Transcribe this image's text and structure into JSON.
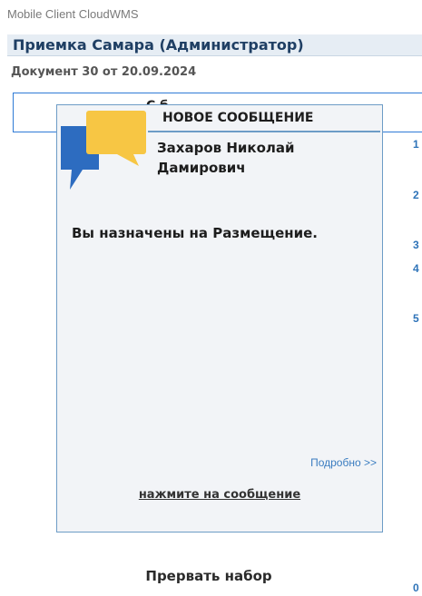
{
  "app": {
    "title": "Mobile Client CloudWMS"
  },
  "header": {
    "title": "Приемка Самара (Администратор)"
  },
  "document": {
    "line": "Документ 30 от 20.09.2024"
  },
  "list": {
    "frame_label": "С б"
  },
  "right_column": {
    "numbers": [
      "1",
      "2",
      "3",
      "4",
      "5",
      "0"
    ]
  },
  "popup": {
    "icon": "chat-bubbles-icon",
    "heading": "НОВОЕ СООБЩЕНИЕ",
    "sender": "Захаров Николай Дамирович",
    "message": "Вы назначены на Размещение.",
    "details_link": "Подробно >>",
    "hint": "нажмите на сообщение"
  },
  "footer": {
    "abort_label": "Прервать набор"
  },
  "colors": {
    "accent": "#2f7bd6",
    "popup_border": "#6d9cc6",
    "bubble_blue": "#2d6cc0",
    "bubble_yellow": "#f7c644"
  }
}
